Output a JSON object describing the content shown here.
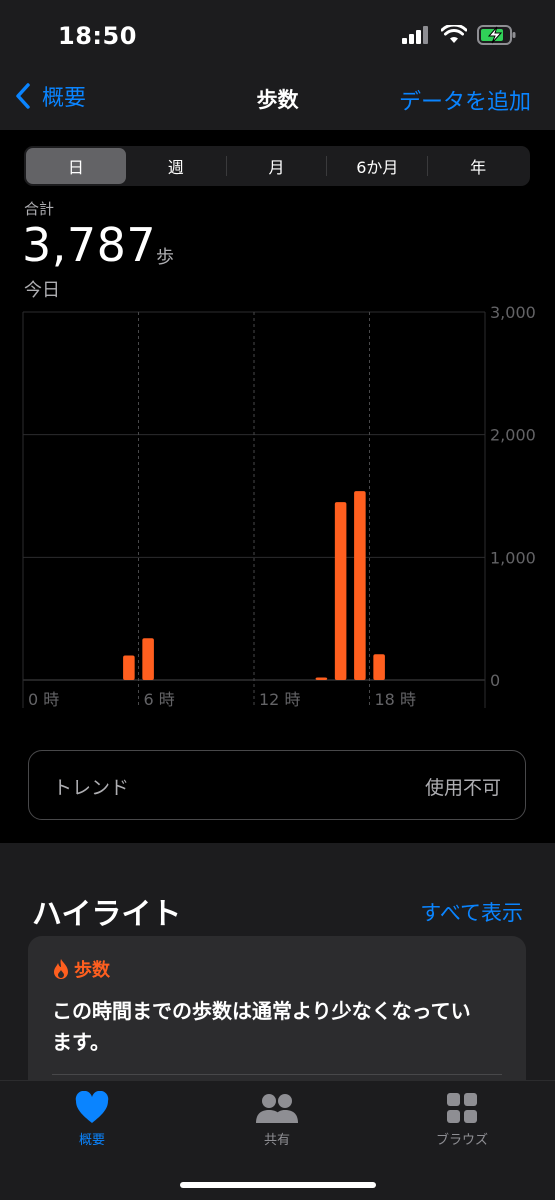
{
  "status": {
    "time": "18:50"
  },
  "nav": {
    "back_label": "概要",
    "title": "歩数",
    "action_label": "データを追加"
  },
  "segments": [
    "日",
    "週",
    "月",
    "6か月",
    "年"
  ],
  "summary": {
    "label": "合計",
    "value": "3,787",
    "unit": "歩",
    "date": "今日"
  },
  "chart_data": {
    "type": "bar",
    "bar_color": "#ff5f1f",
    "x_ticks": [
      {
        "hour": 0,
        "label": "0 時"
      },
      {
        "hour": 6,
        "label": "6 時"
      },
      {
        "hour": 12,
        "label": "12 時"
      },
      {
        "hour": 18,
        "label": "18 時"
      }
    ],
    "y_ticks": [
      {
        "value": 3000,
        "label": "3,000"
      },
      {
        "value": 2000,
        "label": "2,000"
      },
      {
        "value": 1000,
        "label": "1,000"
      },
      {
        "value": 0,
        "label": "0"
      }
    ],
    "ylim": [
      0,
      3000
    ],
    "xlim": [
      0,
      24
    ],
    "bars": [
      {
        "hour": 5,
        "value": 200
      },
      {
        "hour": 6,
        "value": 340
      },
      {
        "hour": 15,
        "value": 20
      },
      {
        "hour": 16,
        "value": 1450
      },
      {
        "hour": 17,
        "value": 1540
      },
      {
        "hour": 18,
        "value": 210
      }
    ]
  },
  "trend": {
    "label": "トレンド",
    "value": "使用不可"
  },
  "highlights": {
    "title": "ハイライト",
    "show_all": "すべて表示",
    "card": {
      "category": "歩数",
      "text": "この時間までの歩数は通常より少なくなっています。"
    }
  },
  "tabs": [
    {
      "label": "概要",
      "icon": "heart-icon",
      "active": true
    },
    {
      "label": "共有",
      "icon": "people-icon",
      "active": false
    },
    {
      "label": "ブラウズ",
      "icon": "grid-icon",
      "active": false
    }
  ],
  "colors": {
    "accent": "#0a84ff",
    "steps": "#ff5f1f",
    "background": "#000000"
  }
}
